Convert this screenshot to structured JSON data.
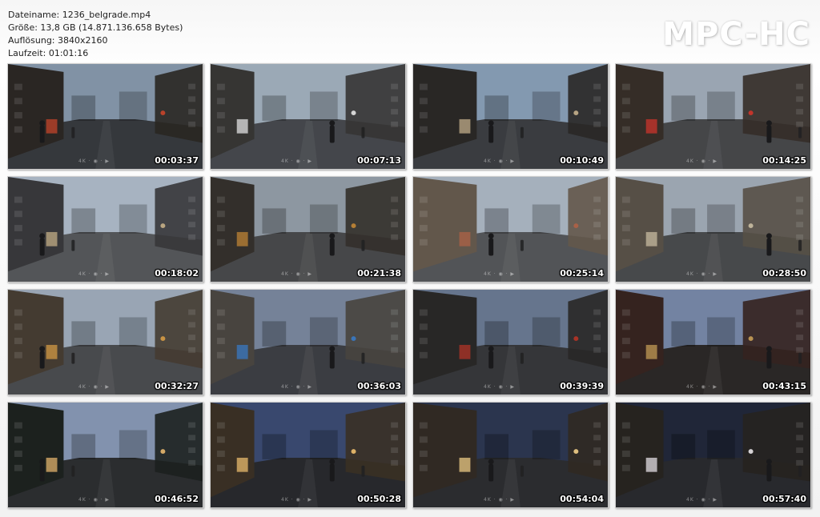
{
  "info": {
    "filename": "Dateiname: 1236_belgrade.mp4",
    "size": "Größe: 13,8 GB (14.871.136.658 Bytes)",
    "resolution": "Auflösung: 3840x2160",
    "duration": "Laufzeit: 01:01:16"
  },
  "logo": "MPC-HC",
  "thumbnails": [
    {
      "time": "00:03:37",
      "sky": "#8d9fb3",
      "ground": "#3a3d42",
      "side": "#2e2a26",
      "accent": "#c9482e"
    },
    {
      "time": "00:07:13",
      "sky": "#a9b8c6",
      "ground": "#4a4d52",
      "side": "#3b3a38",
      "accent": "#e8e8e8"
    },
    {
      "time": "00:10:49",
      "sky": "#8fa6bf",
      "ground": "#3f4246",
      "side": "#2d2b29",
      "accent": "#c7b28f"
    },
    {
      "time": "00:14:25",
      "sky": "#a8b4c2",
      "ground": "#4b4c4f",
      "side": "#3a312b",
      "accent": "#d33a2f"
    },
    {
      "time": "00:18:02",
      "sky": "#b6c3d2",
      "ground": "#5b5d60",
      "side": "#3c3c3f",
      "accent": "#c9b48c"
    },
    {
      "time": "00:21:38",
      "sky": "#9aa4af",
      "ground": "#4d4e50",
      "side": "#38342f",
      "accent": "#c58a3a"
    },
    {
      "time": "00:25:14",
      "sky": "#b3bfcc",
      "ground": "#5a5c5f",
      "side": "#6b5f52",
      "accent": "#b86a4e"
    },
    {
      "time": "00:28:50",
      "sky": "#a9b3bf",
      "ground": "#4e5052",
      "side": "#5e564c",
      "accent": "#cfc3a8"
    },
    {
      "time": "00:32:27",
      "sky": "#a6b4c4",
      "ground": "#4f5154",
      "side": "#4a4036",
      "accent": "#d9a04a"
    },
    {
      "time": "00:36:03",
      "sky": "#7f8ea5",
      "ground": "#414348",
      "side": "#4f4a45",
      "accent": "#3f7fc9"
    },
    {
      "time": "00:39:39",
      "sky": "#6f7f99",
      "ground": "#3a3b3e",
      "side": "#2c2b2a",
      "accent": "#b8382a"
    },
    {
      "time": "00:43:15",
      "sky": "#7d8fb0",
      "ground": "#2e2b2a",
      "side": "#3a2622",
      "accent": "#c9a05a"
    },
    {
      "time": "00:46:52",
      "sky": "#8e9fbd",
      "ground": "#2f3134",
      "side": "#1f2421",
      "accent": "#e6b870"
    },
    {
      "time": "00:50:28",
      "sky": "#3e4f78",
      "ground": "#2b2c30",
      "side": "#3e3428",
      "accent": "#f0c070"
    },
    {
      "time": "00:54:04",
      "sky": "#2f3a55",
      "ground": "#2f3034",
      "side": "#352d26",
      "accent": "#f2d08a"
    },
    {
      "time": "00:57:40",
      "sky": "#232a3d",
      "ground": "#2c2d31",
      "side": "#2a2622",
      "accent": "#e8e4e8"
    }
  ],
  "watermark": "4K  ·  ◉  ·  ▶"
}
